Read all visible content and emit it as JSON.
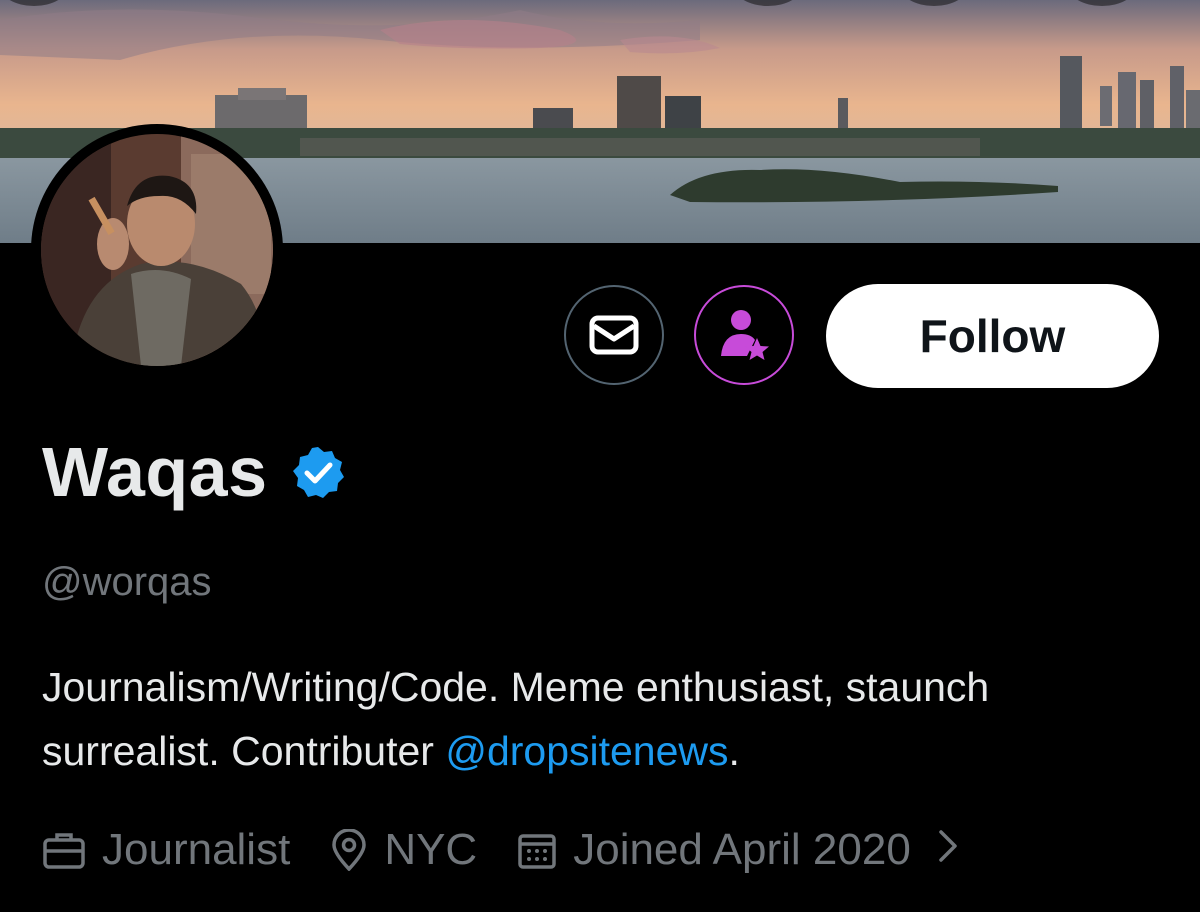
{
  "profile": {
    "display_name": "Waqas",
    "handle": "@worqas",
    "bio_text": "Journalism/Writing/Code. Meme enthusiast, staunch surrealist. Contributer ",
    "bio_mention": "@dropsitenews",
    "bio_end": ".",
    "occupation": "Journalist",
    "location": "NYC",
    "joined": "Joined April 2020"
  },
  "actions": {
    "follow_label": "Follow"
  },
  "icons": {
    "message": "envelope-icon",
    "subscribe": "subscribe-star-icon",
    "verified": "verified-badge-icon",
    "occupation": "briefcase-icon",
    "location": "location-pin-icon",
    "joined": "calendar-icon",
    "more": "chevron-right-icon"
  },
  "colors": {
    "background": "#000000",
    "accent_blue": "#1d9bf0",
    "subscribe_purple": "#c74bd9",
    "muted_text": "#71767b",
    "primary_text": "#e7e9ea"
  }
}
